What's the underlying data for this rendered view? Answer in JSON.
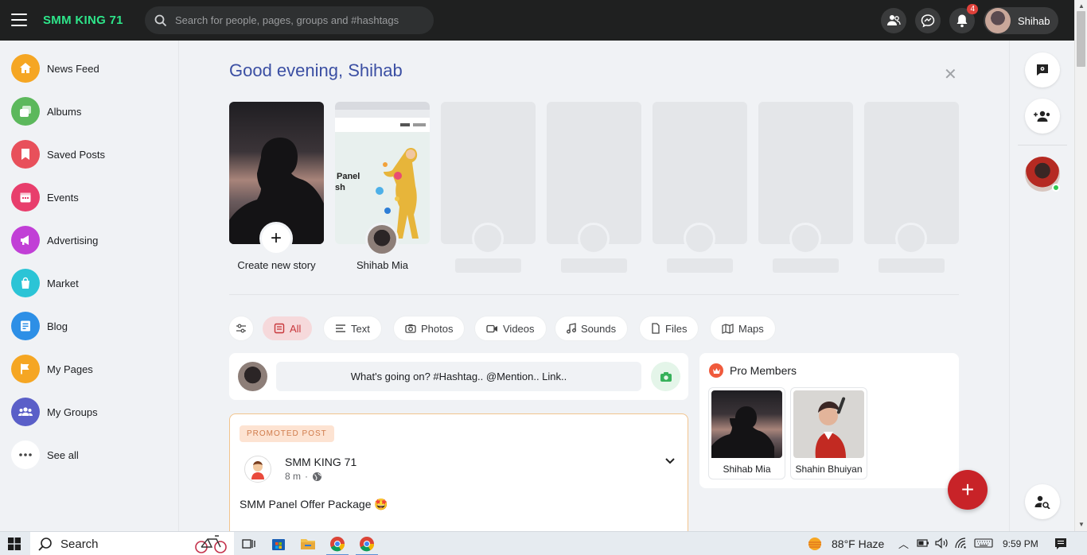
{
  "topbar": {
    "brand": "SMM KING 71",
    "search_placeholder": "Search for people, pages, groups and #hashtags",
    "notification_count": "4",
    "user_name": "Shihab"
  },
  "sidebar": {
    "items": [
      {
        "label": "News Feed",
        "color": "#f5a623"
      },
      {
        "label": "Albums",
        "color": "#5cb85c"
      },
      {
        "label": "Saved Posts",
        "color": "#e8505b"
      },
      {
        "label": "Events",
        "color": "#e83e6c"
      },
      {
        "label": "Advertising",
        "color": "#c13fd6"
      },
      {
        "label": "Market",
        "color": "#2bc4d6"
      },
      {
        "label": "Blog",
        "color": "#2d8fe6"
      },
      {
        "label": "My Pages",
        "color": "#f5a623"
      },
      {
        "label": "My Groups",
        "color": "#5a5fc8"
      },
      {
        "label": "See all",
        "color": "#ffffff"
      }
    ]
  },
  "main": {
    "greeting": "Good evening, Shihab",
    "stories": {
      "create_label": "Create new story",
      "user_story_label": "Shihab Mia",
      "story_panel_text_1": "Panel",
      "story_panel_text_2": "sh"
    },
    "filters": [
      "All",
      "Text",
      "Photos",
      "Videos",
      "Sounds",
      "Files",
      "Maps"
    ],
    "composer_placeholder": "What's going on? #Hashtag.. @Mention.. Link..",
    "post": {
      "promo_label": "PROMOTED POST",
      "author": "SMM KING 71",
      "time": "8 m",
      "text": "SMM Panel Offer Package 🤩"
    },
    "pro_members": {
      "title": "Pro Members",
      "members": [
        {
          "name": "Shihab Mia"
        },
        {
          "name": "Shahin Bhuiyan"
        }
      ]
    }
  },
  "taskbar": {
    "search_label": "Search",
    "weather": "88°F  Haze",
    "time": "9:59 PM"
  },
  "colors": {
    "accent": "#c82328",
    "brand": "#2ee58a",
    "greeting": "#3b4fa3"
  }
}
